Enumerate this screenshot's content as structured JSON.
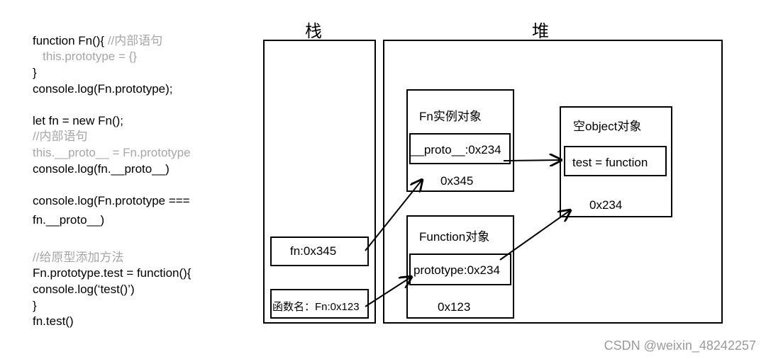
{
  "code": {
    "lines": [
      {
        "text": "function Fn(){ ",
        "comment": "//内部语句"
      },
      {
        "text": "",
        "comment": "   this.prototype = {}"
      },
      {
        "text": "}",
        "comment": ""
      },
      {
        "text": "console.log(Fn.prototype);",
        "comment": ""
      },
      {
        "text": "let fn = new Fn();",
        "comment": ""
      },
      {
        "text": "",
        "comment": "//内部语句"
      },
      {
        "text": "",
        "comment": "this.__proto__ = Fn.prototype"
      },
      {
        "text": "console.log(fn.__proto__)",
        "comment": ""
      },
      {
        "text": "console.log(Fn.prototype ===",
        "comment": ""
      },
      {
        "text": "fn.__proto__)",
        "comment": ""
      },
      {
        "text": "",
        "comment": "//给原型添加方法"
      },
      {
        "text": "Fn.prototype.test = function(){",
        "comment": ""
      },
      {
        "text": "console.log(‘test()’)",
        "comment": ""
      },
      {
        "text": "}",
        "comment": ""
      },
      {
        "text": "fn.test()",
        "comment": ""
      }
    ]
  },
  "diagram": {
    "stack_label": "栈",
    "heap_label": "堆",
    "stack": {
      "fn_var": "fn:0x345",
      "fn_name": "函数名：Fn:0x123"
    },
    "heap": {
      "instance": {
        "title": "Fn实例对象",
        "field": "__proto__:0x234",
        "address": "0x345"
      },
      "function": {
        "title": "Function对象",
        "field": "prototype:0x234",
        "address": "0x123"
      },
      "object": {
        "title": "空object对象",
        "field": "test = function",
        "address": "0x234"
      }
    }
  },
  "watermark": "CSDN @weixin_48242257"
}
